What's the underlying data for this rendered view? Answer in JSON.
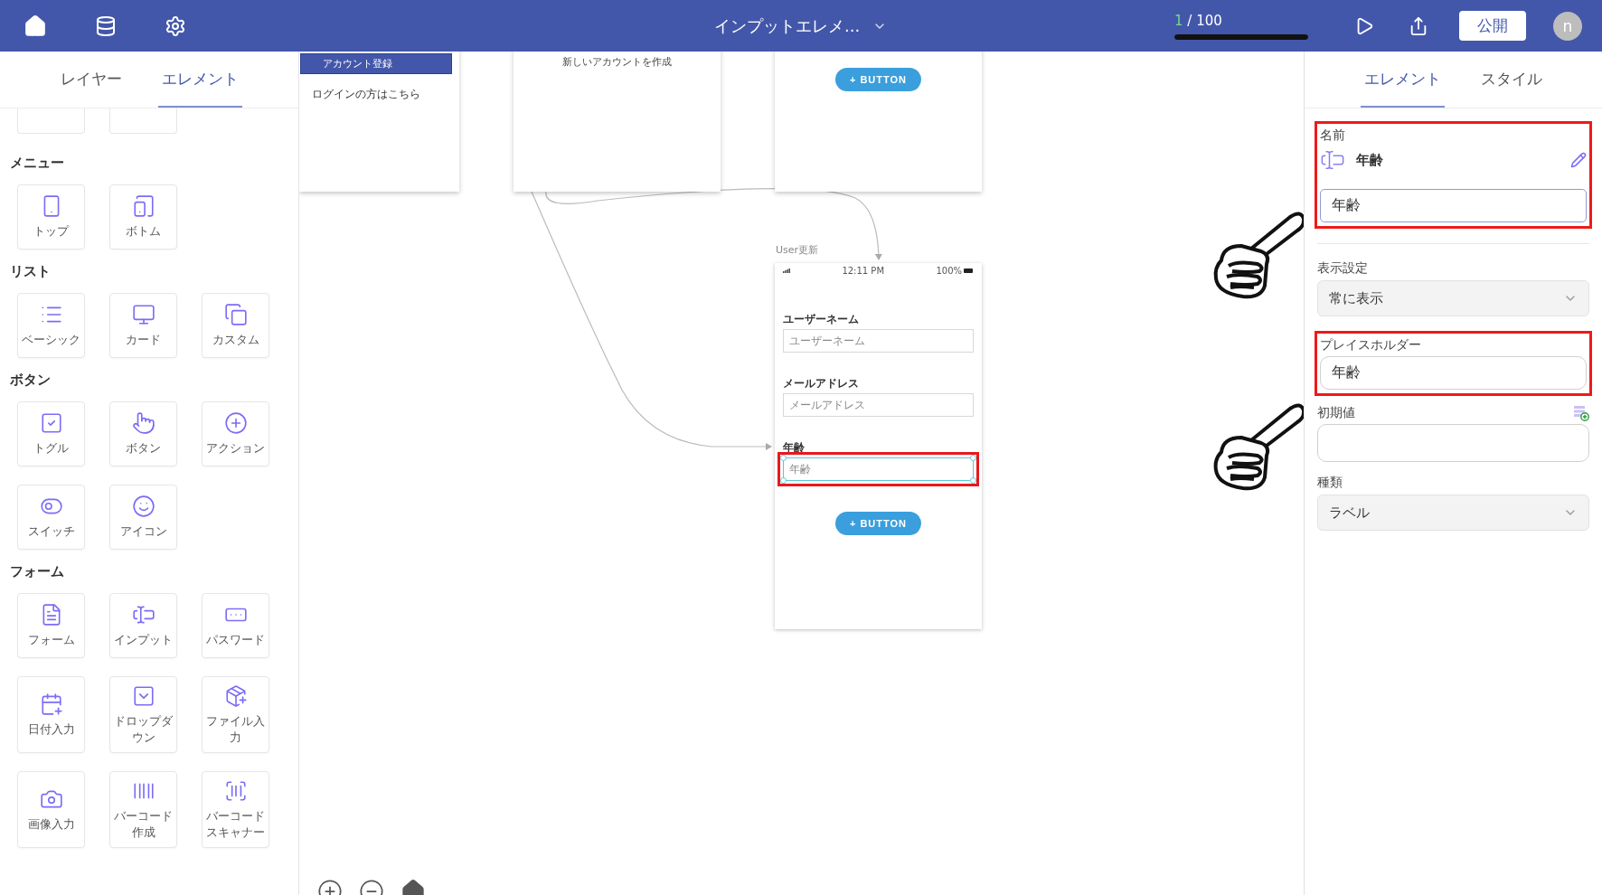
{
  "top_bar": {
    "title": "インプットエレメ...",
    "progress": {
      "current": "1",
      "total": " / 100",
      "level": 1
    },
    "publish_button": "公開",
    "avatar": "n"
  },
  "left_panel": {
    "tabs": [
      {
        "label": "レイヤー",
        "selected": false
      },
      {
        "label": "エレメント",
        "selected": true
      }
    ],
    "sections": [
      {
        "title": "メニュー",
        "items": [
          {
            "label": "トップ",
            "kind": "top"
          },
          {
            "label": "ボトム",
            "kind": "bottom"
          }
        ]
      },
      {
        "title": "リスト",
        "items": [
          {
            "label": "ベーシック",
            "kind": "list"
          },
          {
            "label": "カード",
            "kind": "card"
          },
          {
            "label": "カスタム",
            "kind": "custom"
          }
        ]
      },
      {
        "title": "ボタン",
        "items": [
          {
            "label": "トグル",
            "kind": "toggle"
          },
          {
            "label": "ボタン",
            "kind": "button"
          },
          {
            "label": "アクション",
            "kind": "action"
          },
          {
            "label": "スイッチ",
            "kind": "switch"
          },
          {
            "label": "アイコン",
            "kind": "icon"
          }
        ]
      },
      {
        "title": "フォーム",
        "items": [
          {
            "label": "フォーム",
            "kind": "form"
          },
          {
            "label": "インプット",
            "kind": "input"
          },
          {
            "label": "パスワード",
            "kind": "password"
          },
          {
            "label": "日付入力",
            "kind": "date"
          },
          {
            "label": "ドロップダウン",
            "kind": "dropdown"
          },
          {
            "label": "ファイル入力",
            "kind": "file"
          },
          {
            "label": "画像入力",
            "kind": "image"
          },
          {
            "label": "バーコード作成",
            "kind": "barcode"
          },
          {
            "label": "バーコードスキャナー",
            "kind": "scanner"
          }
        ]
      }
    ]
  },
  "canvas": {
    "screens": [
      {
        "kind": "register",
        "button": "アカウント登録",
        "link": "ログインの方はこちら"
      },
      {
        "kind": "text",
        "text": "新しいアカウントを作成"
      },
      {
        "kind": "button",
        "button": "+ BUTTON"
      }
    ],
    "form_screen": {
      "title": "User更新",
      "time": "12:11 PM",
      "battery": "100%",
      "fields": [
        {
          "label": "ユーザーネーム",
          "placeholder": "ユーザーネーム",
          "selected": false
        },
        {
          "label": "メールアドレス",
          "placeholder": "メールアドレス",
          "selected": false
        },
        {
          "label": "年齢",
          "placeholder": "年齢",
          "selected": true
        }
      ],
      "button": "+ BUTTON"
    }
  },
  "right_panel": {
    "tabs": [
      {
        "label": "エレメント",
        "selected": true
      },
      {
        "label": "スタイル",
        "selected": false
      }
    ],
    "name": {
      "label": "名前",
      "title": "年齢",
      "value": "年齢",
      "highlighted": true
    },
    "visibility": {
      "label": "表示設定",
      "value": "常に表示"
    },
    "placeholder": {
      "label": "プレイスホルダー",
      "value": "年齢",
      "highlighted": true
    },
    "initial_value": {
      "label": "初期値"
    },
    "type": {
      "label": "種類",
      "value": "ラベル"
    }
  }
}
